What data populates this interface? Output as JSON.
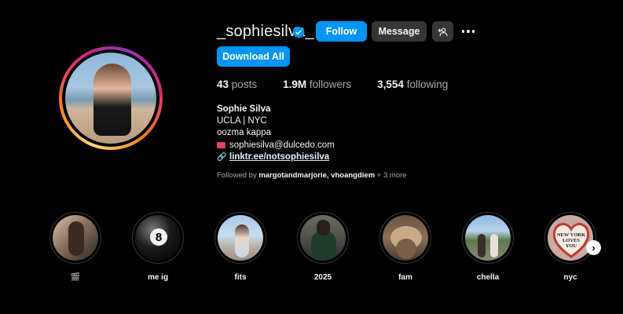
{
  "profile": {
    "username": "_sophiesilva_",
    "verified": true,
    "buttons": {
      "follow": "Follow",
      "message": "Message",
      "download": "Download All",
      "add_user_icon": "add-user-icon",
      "more_icon": "more-options-icon"
    },
    "stats": {
      "posts_count": "43",
      "posts_label": "posts",
      "followers_count": "1.9M",
      "followers_label": "followers",
      "following_count": "3,554",
      "following_label": "following"
    },
    "bio": {
      "name": "Sophie Silva",
      "line1": "UCLA | NYC",
      "line2": "oozma kappa",
      "email": "sophiesilva@dulcedo.com",
      "link": "linktr.ee/notsophiesilva"
    },
    "followed_by": {
      "prefix": "Followed by",
      "names": "margotandmarjorie, vhoangdiem",
      "more": "+ 3 more"
    }
  },
  "highlights": [
    {
      "label": "🎬"
    },
    {
      "label": "me ig"
    },
    {
      "label": "fits"
    },
    {
      "label": "2025"
    },
    {
      "label": "fam"
    },
    {
      "label": "chella"
    },
    {
      "label": "nyc"
    }
  ],
  "colors": {
    "background": "#000000",
    "primary_button": "#0095f6",
    "secondary_button": "#363636",
    "verified_badge": "#0095f6"
  }
}
